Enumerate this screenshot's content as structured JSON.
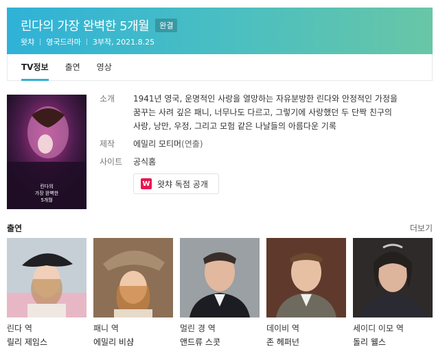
{
  "header": {
    "title": "린다의 가장 완벽한 5개월",
    "badge": "완결",
    "meta": [
      "왓챠",
      "영국드라마",
      "3부작, 2021.8.25"
    ]
  },
  "tabs": [
    {
      "label": "TV정보",
      "active": true
    },
    {
      "label": "출연",
      "active": false
    },
    {
      "label": "영상",
      "active": false
    }
  ],
  "poster": {
    "title_lines": [
      "린다의",
      "가장 완벽한",
      "5개월"
    ]
  },
  "info": {
    "synopsis_label": "소개",
    "synopsis_lines": [
      "1941년 영국, 운명적인 사랑을 열망하는 자유분방한 린다와 안정적인 가정을",
      "꿈꾸는 사려 깊은 패니, 너무나도 다르고, 그렇기에 사랑했던 두 단짝 친구의",
      "사랑, 낭만, 우정, 그리고 모험 같은 나날들의 아름다운 기록"
    ],
    "production_label": "제작",
    "production_name": "에밀리 모티머",
    "production_role": "(연출)",
    "site_label": "사이트",
    "site_link": "공식홈"
  },
  "watcha_button": {
    "logo": "W",
    "label": "왓챠 독점 공개"
  },
  "cast": {
    "title": "출연",
    "more": "더보기",
    "members": [
      {
        "role": "린다 역",
        "name": "릴리 제임스"
      },
      {
        "role": "패니 역",
        "name": "에밀리 비샴"
      },
      {
        "role": "멀린 경 역",
        "name": "앤드류 스콧"
      },
      {
        "role": "데이비 역",
        "name": "존 헤퍼넌"
      },
      {
        "role": "세이디 이모 역",
        "name": "돌리 웰스"
      }
    ]
  },
  "colors": {
    "header_gradient_start": "#2fb2d8",
    "header_gradient_end": "#68c6a6",
    "tab_underline": "#2fb2d8",
    "watcha_brand": "#e8164f"
  }
}
